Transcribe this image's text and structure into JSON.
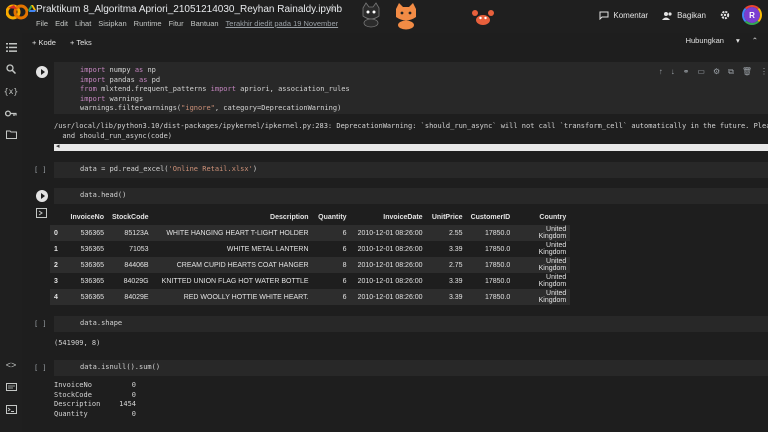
{
  "header": {
    "title": "Praktikum 8_Algoritma Apriori_21051214030_Reyhan Rainaldy.ipynb",
    "menu": [
      "File",
      "Edit",
      "Lihat",
      "Sisipkan",
      "Runtime",
      "Fitur",
      "Bantuan"
    ],
    "last_edit": "Terakhir diedit pada 19 November",
    "comment_label": "Komentar",
    "share_label": "Bagikan",
    "avatar_letter": "R"
  },
  "toolbar": {
    "code_label": "+ Kode",
    "text_label": "+ Teks",
    "connect_label": "Hubungkan"
  },
  "cells": {
    "imports": {
      "lines": [
        [
          "import",
          " numpy ",
          "as",
          " np"
        ],
        [
          "import",
          " pandas ",
          "as",
          " pd"
        ],
        [
          "from",
          " mlxtend.frequent_patterns ",
          "import",
          " apriori, association_rules"
        ],
        [
          "import",
          " warnings",
          "",
          ""
        ],
        [
          "",
          "warnings.filterwarnings(",
          "\"ignore\"",
          ", category=DeprecationWarning)"
        ]
      ],
      "warning_line1": "/usr/local/lib/python3.10/dist-packages/ipykernel/ipkernel.py:283: DeprecationWarning: `should_run_async` will not call `transform_cell` automatically in the future. Please pass the re",
      "warning_line2": "  and should_run_async(code)"
    },
    "read": {
      "exec": "[ ]",
      "code_prefix": "data = pd.read_excel(",
      "code_str": "'Online Retail.xlsx'",
      "code_suffix": ")"
    },
    "head": {
      "code": "data.head()",
      "columns": [
        "",
        "InvoiceNo",
        "StockCode",
        "Description",
        "Quantity",
        "InvoiceDate",
        "UnitPrice",
        "CustomerID",
        "Country"
      ],
      "rows": [
        [
          "0",
          "536365",
          "85123A",
          "WHITE HANGING HEART T-LIGHT HOLDER",
          "6",
          "2010-12-01 08:26:00",
          "2.55",
          "17850.0",
          "United Kingdom"
        ],
        [
          "1",
          "536365",
          "71053",
          "WHITE METAL LANTERN",
          "6",
          "2010-12-01 08:26:00",
          "3.39",
          "17850.0",
          "United Kingdom"
        ],
        [
          "2",
          "536365",
          "84406B",
          "CREAM CUPID HEARTS COAT HANGER",
          "8",
          "2010-12-01 08:26:00",
          "2.75",
          "17850.0",
          "United Kingdom"
        ],
        [
          "3",
          "536365",
          "84029G",
          "KNITTED UNION FLAG HOT WATER BOTTLE",
          "6",
          "2010-12-01 08:26:00",
          "3.39",
          "17850.0",
          "United Kingdom"
        ],
        [
          "4",
          "536365",
          "84029E",
          "RED WOOLLY HOTTIE WHITE HEART.",
          "6",
          "2010-12-01 08:26:00",
          "3.39",
          "17850.0",
          "United Kingdom"
        ]
      ]
    },
    "shape": {
      "exec": "[ ]",
      "code": "data.shape",
      "output": "(541909, 8)"
    },
    "isnull": {
      "exec": "[ ]",
      "code": "data.isnull().sum()",
      "output": [
        [
          "InvoiceNo",
          "0"
        ],
        [
          "StockCode",
          "0"
        ],
        [
          "Description",
          "1454"
        ],
        [
          "Quantity",
          "0"
        ]
      ]
    }
  }
}
